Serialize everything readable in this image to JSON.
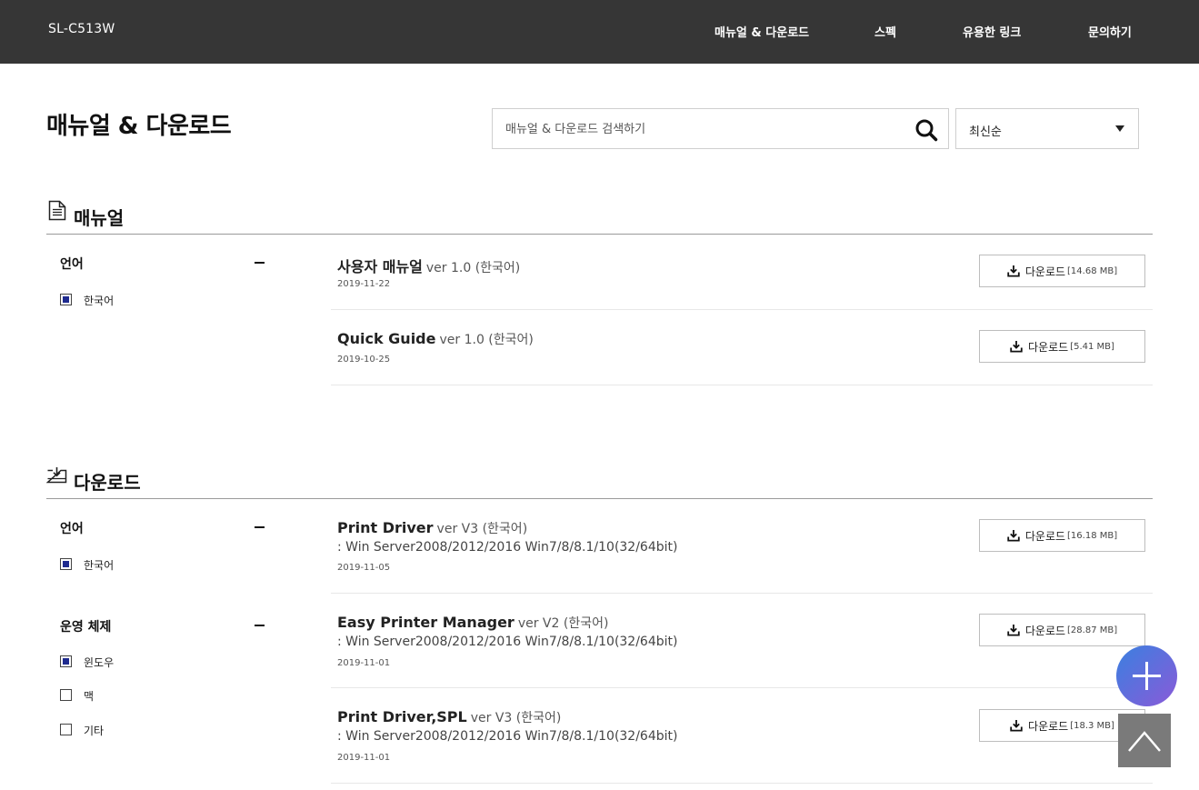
{
  "header": {
    "brand": "SL-C513W",
    "nav": [
      "매뉴얼 & 다운로드",
      "스펙",
      "유용한 링크",
      "문의하기"
    ]
  },
  "page": {
    "title": "매뉴얼 & 다운로드",
    "search_placeholder": "매뉴얼 & 다운로드 검색하기",
    "sort_value": "최신순"
  },
  "manual": {
    "title": "매뉴얼",
    "filters": {
      "language": {
        "heading": "언어",
        "options": [
          {
            "label": "한국어",
            "checked": true
          }
        ]
      }
    },
    "items": [
      {
        "name": "사용자 매뉴얼",
        "version": "ver 1.0 (한국어)",
        "date": "2019-11-22",
        "button": "다운로드",
        "size": "[14.68 MB]"
      },
      {
        "name": "Quick Guide",
        "version": "ver 1.0 (한국어)",
        "date": "2019-10-25",
        "button": "다운로드",
        "size": "[5.41 MB]"
      }
    ]
  },
  "download": {
    "title": "다운로드",
    "filters": {
      "language": {
        "heading": "언어",
        "options": [
          {
            "label": "한국어",
            "checked": true
          }
        ]
      },
      "os": {
        "heading": "운영 체제",
        "options": [
          {
            "label": "윈도우",
            "checked": true
          },
          {
            "label": "맥",
            "checked": false
          },
          {
            "label": "기타",
            "checked": false
          }
        ]
      }
    },
    "items": [
      {
        "name": "Print Driver",
        "version": "ver V3 (한국어)",
        "os": ": Win Server2008/2012/2016 Win7/8/8.1/10(32/64bit)",
        "date": "2019-11-05",
        "button": "다운로드",
        "size": "[16.18 MB]"
      },
      {
        "name": "Easy Printer Manager",
        "version": "ver V2 (한국어)",
        "os": ": Win Server2008/2012/2016 Win7/8/8.1/10(32/64bit)",
        "date": "2019-11-01",
        "button": "다운로드",
        "size": "[28.87 MB]"
      },
      {
        "name": "Print Driver,SPL",
        "version": "ver V3 (한국어)",
        "os": ": Win Server2008/2012/2016 Win7/8/8.1/10(32/64bit)",
        "date": "2019-11-01",
        "button": "다운로드",
        "size": "[18.3 MB]"
      }
    ]
  },
  "colors": {
    "header_bg": "#363636",
    "checkbox_fill": "#1f2b8f",
    "fab_gradient_start": "#3a80e0",
    "fab_gradient_end": "#8a5ad8",
    "top_button_bg": "#7a7a7a"
  },
  "icons": {
    "search": "search-icon",
    "sort": "chevron-down-icon",
    "manual_section": "document-icon",
    "download_section": "download-box-icon",
    "download_button": "download-icon",
    "fab": "plus-icon",
    "top": "arrow-up-icon"
  }
}
